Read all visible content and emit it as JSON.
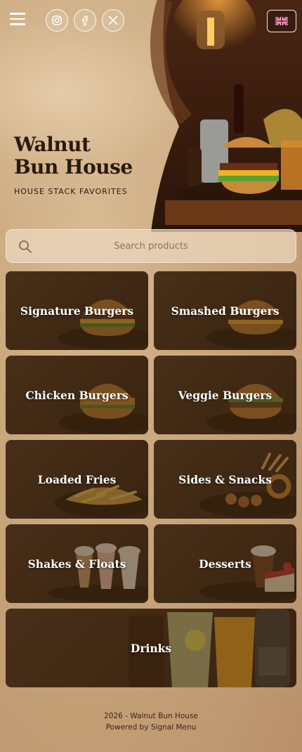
{
  "header": {
    "menu_icon": "hamburger-menu-icon",
    "social": [
      {
        "name": "instagram",
        "icon": "instagram-icon"
      },
      {
        "name": "facebook",
        "icon": "facebook-icon"
      },
      {
        "name": "x",
        "icon": "x-icon"
      }
    ],
    "language_icon": "uk-flag-icon"
  },
  "brand": {
    "title_line1": "Walnut",
    "title_line2": "Bun House",
    "tagline": "HOUSE STACK FAVORITES"
  },
  "search": {
    "placeholder": "Search products",
    "icon": "search-icon"
  },
  "categories": [
    {
      "label": "Signature Burgers",
      "image": "burger"
    },
    {
      "label": "Smashed Burgers",
      "image": "burger"
    },
    {
      "label": "Chicken Burgers",
      "image": "burger"
    },
    {
      "label": "Veggie Burgers",
      "image": "burger"
    },
    {
      "label": "Loaded Fries",
      "image": "fries"
    },
    {
      "label": "Sides & Snacks",
      "image": "snacks"
    },
    {
      "label": "Shakes & Floats",
      "image": "shakes"
    },
    {
      "label": "Desserts",
      "image": "desserts"
    },
    {
      "label": "Drinks",
      "image": "drinks"
    }
  ],
  "footer": {
    "copyright": "2026 - Walnut Bun House",
    "powered_by": "Powered by Signal Menu"
  },
  "colors": {
    "background": "#c9a67c",
    "tile_overlay": "#46301a",
    "text_dark": "#2a1a0f",
    "text_light": "#ffffff"
  }
}
